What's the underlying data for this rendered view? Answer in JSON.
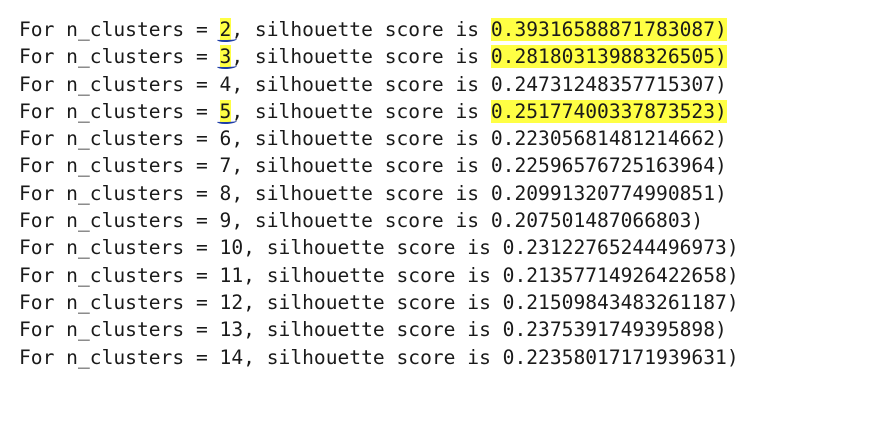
{
  "output": {
    "lines": [
      {
        "prefix": "For n_clusters = ",
        "n": "2",
        "mid": ", silhouette score is ",
        "score": "0.39316588871783087",
        "suffix": ")",
        "highlight": true,
        "underline": true
      },
      {
        "prefix": "For n_clusters = ",
        "n": "3",
        "mid": ", silhouette score is ",
        "score": "0.28180313988326505",
        "suffix": ")",
        "highlight": true,
        "underline": true
      },
      {
        "prefix": "For n_clusters = ",
        "n": "4",
        "mid": ", silhouette score is ",
        "score": "0.24731248357715307",
        "suffix": ")",
        "highlight": false,
        "underline": false
      },
      {
        "prefix": "For n_clusters = ",
        "n": "5",
        "mid": ", silhouette score is ",
        "score": "0.25177400337873523",
        "suffix": ")",
        "highlight": true,
        "underline": true
      },
      {
        "prefix": "For n_clusters = ",
        "n": "6",
        "mid": ", silhouette score is ",
        "score": "0.22305681481214662",
        "suffix": ")",
        "highlight": false,
        "underline": false
      },
      {
        "prefix": "For n_clusters = ",
        "n": "7",
        "mid": ", silhouette score is ",
        "score": "0.22596576725163964",
        "suffix": ")",
        "highlight": false,
        "underline": false
      },
      {
        "prefix": "For n_clusters = ",
        "n": "8",
        "mid": ", silhouette score is ",
        "score": "0.20991320774990851",
        "suffix": ")",
        "highlight": false,
        "underline": false
      },
      {
        "prefix": "For n_clusters = ",
        "n": "9",
        "mid": ", silhouette score is ",
        "score": "0.207501487066803",
        "suffix": ")",
        "highlight": false,
        "underline": false
      },
      {
        "prefix": "For n_clusters = ",
        "n": "10",
        "mid": ", silhouette score is ",
        "score": "0.23122765244496973",
        "suffix": ")",
        "highlight": false,
        "underline": false
      },
      {
        "prefix": "For n_clusters = ",
        "n": "11",
        "mid": ", silhouette score is ",
        "score": "0.21357714926422658",
        "suffix": ")",
        "highlight": false,
        "underline": false
      },
      {
        "prefix": "For n_clusters = ",
        "n": "12",
        "mid": ", silhouette score is ",
        "score": "0.21509843483261187",
        "suffix": ")",
        "highlight": false,
        "underline": false
      },
      {
        "prefix": "For n_clusters = ",
        "n": "13",
        "mid": ", silhouette score is ",
        "score": "0.2375391749395898",
        "suffix": ")",
        "highlight": false,
        "underline": false
      },
      {
        "prefix": "For n_clusters = ",
        "n": "14",
        "mid": ", silhouette score is ",
        "score": "0.22358017171939631",
        "suffix": ")",
        "highlight": false,
        "underline": false
      }
    ],
    "colors": {
      "highlight": "#ffff44",
      "underline_ink": "#1f3ea6",
      "text": "#1a1a1a",
      "background": "#ffffff"
    }
  }
}
